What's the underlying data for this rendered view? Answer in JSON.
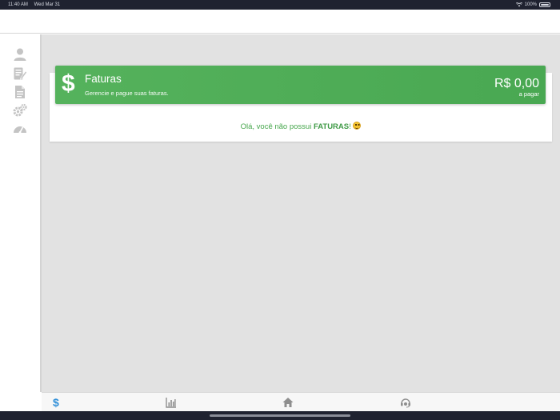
{
  "status_bar": {
    "time": "11:40 AM",
    "date": "Wed Mar 31",
    "battery": "100%"
  },
  "sidebar": {
    "items": [
      {
        "icon": "user-icon"
      },
      {
        "icon": "edit-document-icon"
      },
      {
        "icon": "document-icon"
      },
      {
        "icon": "gears-icon"
      },
      {
        "icon": "dashboard-icon"
      }
    ]
  },
  "invoices": {
    "icon": "dollar-icon",
    "title": "Faturas",
    "subtitle": "Gerencie e pague suas faturas.",
    "amount": "R$ 0,00",
    "amount_label": "a pagar",
    "empty_prefix": "Olá, você não possui ",
    "empty_emphasis": "FATURAS",
    "empty_suffix": "! ",
    "accent_color": "#4cae55"
  },
  "tab_bar": {
    "tabs": [
      {
        "icon": "dollar-icon",
        "active": true
      },
      {
        "icon": "chart-icon",
        "active": false
      },
      {
        "icon": "home-icon",
        "active": false
      },
      {
        "icon": "support-icon",
        "active": false
      }
    ],
    "active_color": "#2f8fd8",
    "inactive_color": "#8e8e8e"
  }
}
